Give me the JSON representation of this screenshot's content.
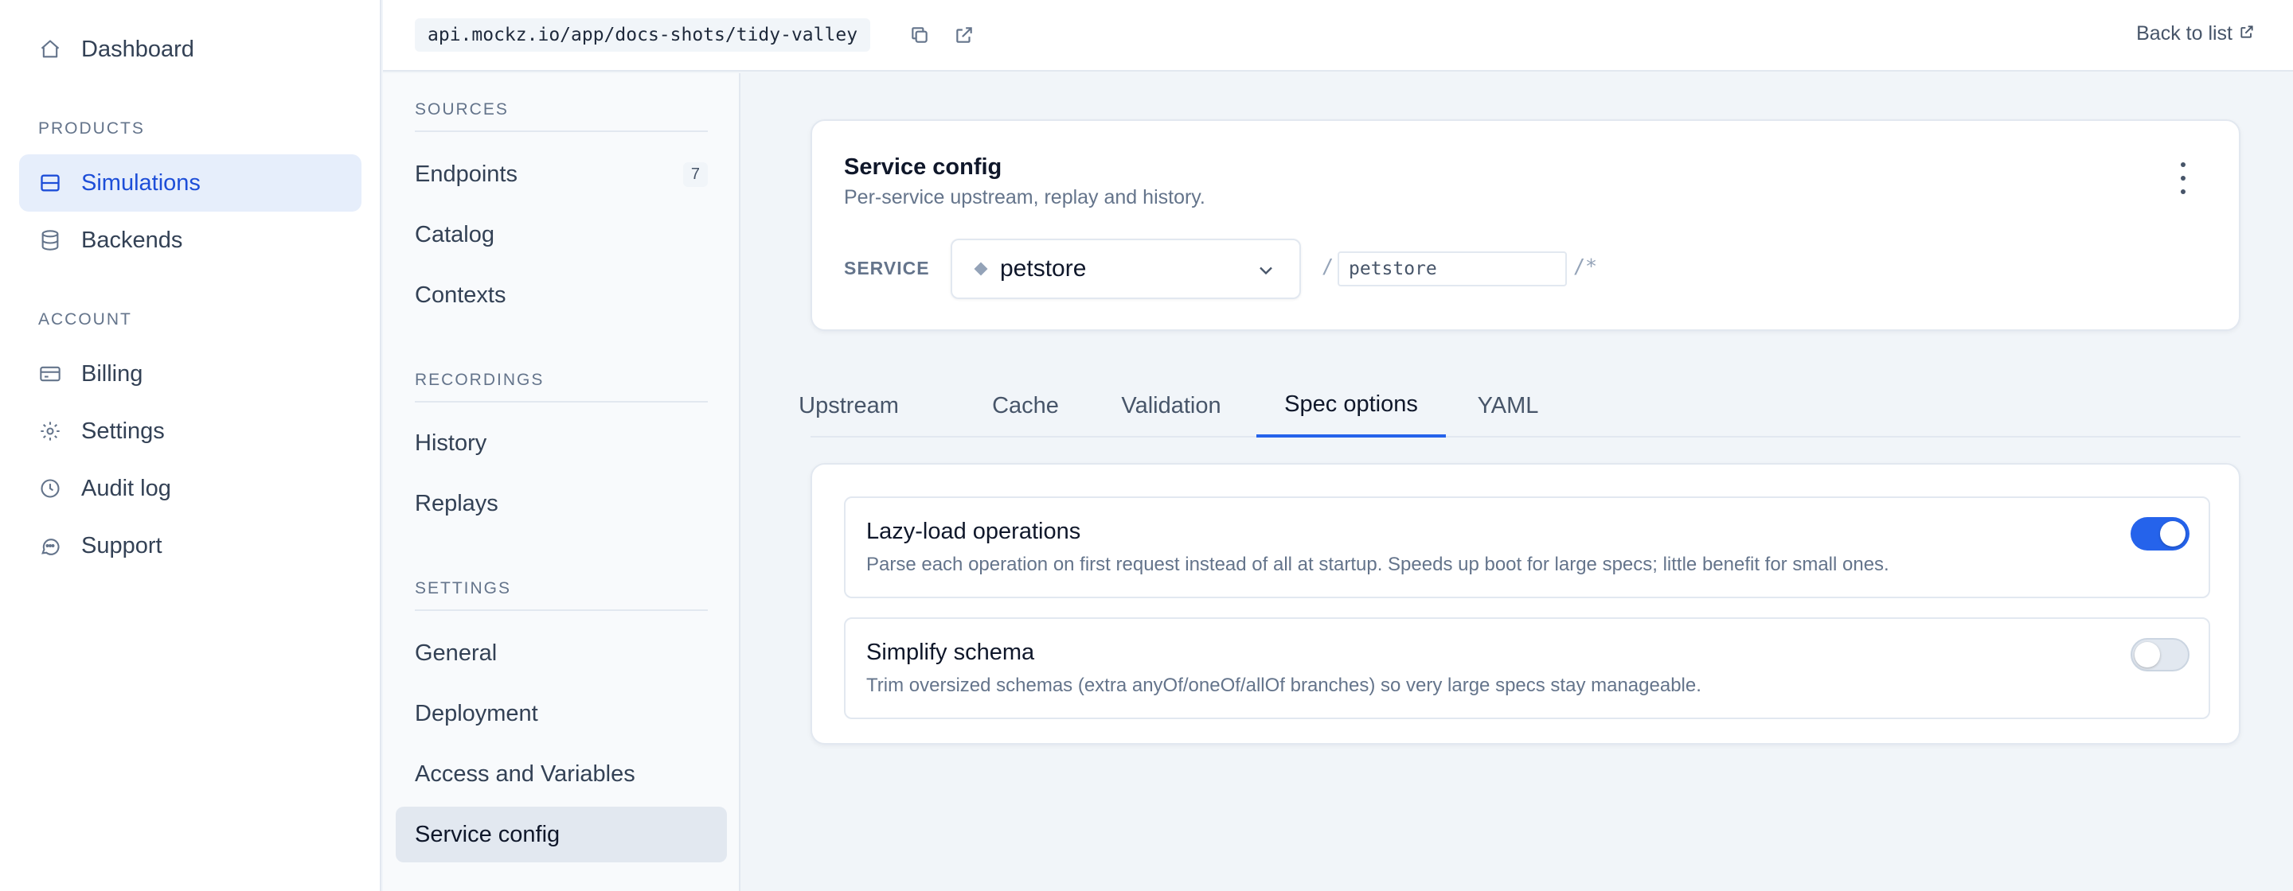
{
  "sidebar": {
    "dashboard": "Dashboard",
    "products_heading": "PRODUCTS",
    "simulations": "Simulations",
    "backends": "Backends",
    "account_heading": "ACCOUNT",
    "billing": "Billing",
    "settings": "Settings",
    "audit_log": "Audit log",
    "support": "Support"
  },
  "topbar": {
    "url": "api.mockz.io/app/docs-shots/tidy-valley",
    "back_label": "Back to list"
  },
  "subnav": {
    "sources_heading": "SOURCES",
    "endpoints": "Endpoints",
    "endpoints_count": "7",
    "catalog": "Catalog",
    "contexts": "Contexts",
    "recordings_heading": "RECORDINGS",
    "history": "History",
    "replays": "Replays",
    "settings_heading": "SETTINGS",
    "general": "General",
    "deployment": "Deployment",
    "access_variables": "Access and Variables",
    "service_config": "Service config"
  },
  "service_card": {
    "title": "Service config",
    "subtitle": "Per-service upstream, replay and history.",
    "service_label": "SERVICE",
    "service_value": "petstore",
    "path_prefix": "/",
    "path_value": "petstore",
    "path_suffix": "/*"
  },
  "tabs": [
    "Upstream",
    "Cache",
    "Validation",
    "Spec options",
    "YAML"
  ],
  "active_tab": "Spec options",
  "options": [
    {
      "title": "Lazy-load operations",
      "description": "Parse each operation on first request instead of all at startup. Speeds up boot for large specs; little benefit for small ones.",
      "enabled": true
    },
    {
      "title": "Simplify schema",
      "description": "Trim oversized schemas (extra anyOf/oneOf/allOf branches) so very large specs stay manageable.",
      "enabled": false
    }
  ],
  "colors": {
    "accent": "#2563eb",
    "active_nav_bg": "#e6eefb",
    "page_bg": "#f1f5f9"
  },
  "icons": {
    "dashboard": "home-icon",
    "simulations": "layout-icon",
    "backends": "database-icon",
    "billing": "credit-card-icon",
    "settings": "gear-icon",
    "audit_log": "clock-icon",
    "support": "chat-icon",
    "copy": "copy-icon",
    "open": "external-link-icon"
  }
}
